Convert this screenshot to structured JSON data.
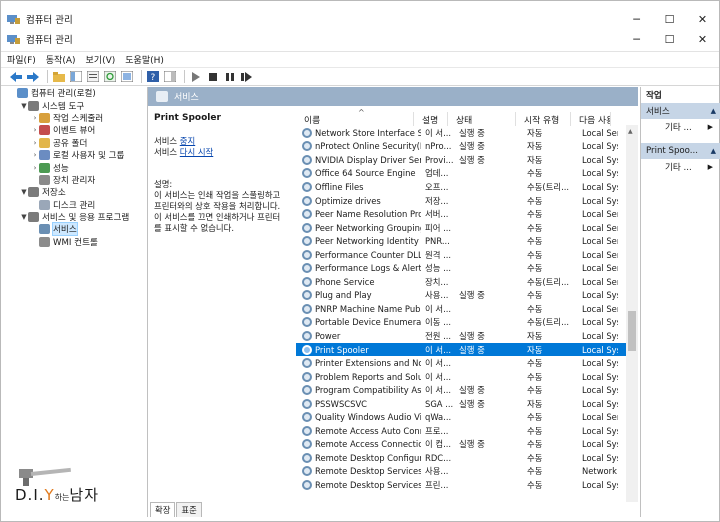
{
  "outer_window": {
    "title": "컴퓨터 관리"
  },
  "inner_window": {
    "title": "컴퓨터 관리"
  },
  "window_controls": {
    "minimize": "─",
    "maximize": "☐",
    "close": "✕"
  },
  "menu": [
    "파일(F)",
    "동작(A)",
    "보기(V)",
    "도움말(H)"
  ],
  "tree": [
    {
      "label": "컴퓨터 관리(로컬)",
      "level": 0,
      "exp": ""
    },
    {
      "label": "시스템 도구",
      "level": 1,
      "exp": "▼"
    },
    {
      "label": "작업 스케줄러",
      "level": 2,
      "exp": "›"
    },
    {
      "label": "이벤트 뷰어",
      "level": 2,
      "exp": "›"
    },
    {
      "label": "공유 폴더",
      "level": 2,
      "exp": "›"
    },
    {
      "label": "로컬 사용자 및 그룹",
      "level": 2,
      "exp": "›"
    },
    {
      "label": "성능",
      "level": 2,
      "exp": "›"
    },
    {
      "label": "장치 관리자",
      "level": 2,
      "exp": ""
    },
    {
      "label": "저장소",
      "level": 1,
      "exp": "▼"
    },
    {
      "label": "디스크 관리",
      "level": 2,
      "exp": ""
    },
    {
      "label": "서비스 및 응용 프로그램",
      "level": 1,
      "exp": "▼"
    },
    {
      "label": "서비스",
      "level": 2,
      "exp": "",
      "selected": true
    },
    {
      "label": "WMI 컨트롤",
      "level": 2,
      "exp": ""
    }
  ],
  "center": {
    "header": "서비스",
    "detail": {
      "name": "Print Spooler",
      "stop_prefix": "서비스 ",
      "stop_link": "중지",
      "restart_prefix": "서비스 ",
      "restart_link": "다시 시작",
      "desc_label": "설명:",
      "desc_text": [
        "이 서비스는 인쇄 작업을 스풀링하고",
        "프린터와의 상호 작용을 처리합니다.",
        "이 서비스를 끄면 인쇄하거나 프린터",
        "를 표시할 수 없습니다."
      ]
    },
    "columns": [
      "이름",
      "설명",
      "상태",
      "시작 유형",
      "다음 사용자"
    ],
    "rows": [
      [
        "Network Store Interface Se...",
        "이 서...",
        "실행 중",
        "자동",
        "Local Ser"
      ],
      [
        "nProtect Online Security(P...",
        "nPro...",
        "실행 중",
        "자동",
        "Local Sys"
      ],
      [
        "NVIDIA Display Driver Serv...",
        "Provi...",
        "실행 중",
        "자동",
        "Local Sys"
      ],
      [
        "Office 64 Source Engine",
        "업데...",
        "",
        "수동",
        "Local Sys"
      ],
      [
        "Offline Files",
        "오프...",
        "",
        "수동(트리...",
        "Local Sys"
      ],
      [
        "Optimize drives",
        "저장...",
        "",
        "수동",
        "Local Sys"
      ],
      [
        "Peer Name Resolution Prot...",
        "서버...",
        "",
        "수동",
        "Local Ser"
      ],
      [
        "Peer Networking Grouping",
        "피어 ...",
        "",
        "수동",
        "Local Ser"
      ],
      [
        "Peer Networking Identity ...",
        "PNR...",
        "",
        "수동",
        "Local Ser"
      ],
      [
        "Performance Counter DLL ...",
        "원격 ...",
        "",
        "수동",
        "Local Ser"
      ],
      [
        "Performance Logs & Alerts",
        "성능 ...",
        "",
        "수동",
        "Local Ser"
      ],
      [
        "Phone Service",
        "장치...",
        "",
        "수동(트리...",
        "Local Ser"
      ],
      [
        "Plug and Play",
        "사용...",
        "실행 중",
        "수동",
        "Local Sys"
      ],
      [
        "PNRP Machine Name Publi...",
        "이 서...",
        "",
        "수동",
        "Local Ser"
      ],
      [
        "Portable Device Enumerato...",
        "이동 ...",
        "",
        "수동(트리...",
        "Local Sys"
      ],
      [
        "Power",
        "전원 ...",
        "실행 중",
        "자동",
        "Local Sys"
      ],
      [
        "Print Spooler",
        "이 서...",
        "실행 중",
        "자동",
        "Local Sys"
      ],
      [
        "Printer Extensions and Noti...",
        "이 서...",
        "",
        "수동",
        "Local Sys"
      ],
      [
        "Problem Reports and Soluti...",
        "이 서...",
        "",
        "수동",
        "Local Sys"
      ],
      [
        "Program Compatibility Assi...",
        "이 서...",
        "실행 중",
        "수동",
        "Local Sys"
      ],
      [
        "PSSWSCSVC",
        "SGA ...",
        "실행 중",
        "자동",
        "Local Sys"
      ],
      [
        "Quality Windows Audio Vi...",
        "qWa...",
        "",
        "수동",
        "Local Ser"
      ],
      [
        "Remote Access Auto Conn...",
        "프로...",
        "",
        "수동",
        "Local Sys"
      ],
      [
        "Remote Access Connection...",
        "이 컴...",
        "실행 중",
        "수동",
        "Local Sys"
      ],
      [
        "Remote Desktop Configura...",
        "RDC...",
        "",
        "수동",
        "Local Sys"
      ],
      [
        "Remote Desktop Services",
        "사용...",
        "",
        "수동",
        "Network"
      ],
      [
        "Remote Desktop Services ...",
        "프린...",
        "",
        "수동",
        "Local Sys"
      ]
    ],
    "selected_row": 16,
    "tabs": [
      "확장",
      "표준"
    ]
  },
  "actions": {
    "header": "작업",
    "sections": [
      {
        "title": "서비스",
        "item": "기타 ..."
      },
      {
        "title": "Print Spoo...",
        "item": "기타 ..."
      }
    ]
  },
  "watermark": {
    "part1": "D.I.",
    "part2": "Y",
    "part3": "하는",
    "part4": "남자"
  },
  "colors": {
    "selection": "#0078d7",
    "header_band": "#9ab0c8",
    "action_section": "#c6d5e6"
  }
}
